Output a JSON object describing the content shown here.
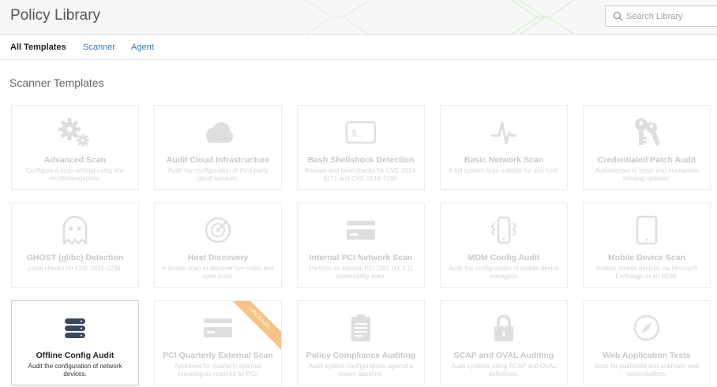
{
  "header": {
    "title": "Policy Library",
    "search_placeholder": "Search Library"
  },
  "tabs": [
    {
      "label": "All Templates"
    },
    {
      "label": "Scanner"
    },
    {
      "label": "Agent"
    }
  ],
  "section_title": "Scanner Templates",
  "cards": [
    {
      "title": "Advanced Scan",
      "desc": "Configure a scan without using any recommendations.",
      "icon": "gears-icon"
    },
    {
      "title": "Audit Cloud Infrastructure",
      "desc": "Audit the configuration of third-party cloud services.",
      "icon": "cloud-icon"
    },
    {
      "title": "Bash Shellshock Detection",
      "desc": "Remote and local checks for CVE-2014-6271 and CVE-2014-7169.",
      "icon": "terminal-icon"
    },
    {
      "title": "Basic Network Scan",
      "desc": "A full system scan suitable for any host.",
      "icon": "pulse-icon"
    },
    {
      "title": "Credentialed Patch Audit",
      "desc": "Authenticate to hosts and enumerate missing updates.",
      "icon": "keys-icon"
    },
    {
      "title": "GHOST (glibc) Detection",
      "desc": "Local checks for CVE-2015-0235.",
      "icon": "ghost-icon"
    },
    {
      "title": "Host Discovery",
      "desc": "A simple scan to discover live hosts and open ports.",
      "icon": "radar-icon"
    },
    {
      "title": "Internal PCI Network Scan",
      "desc": "Perform an internal PCI DSS (11.2.1) vulnerability scan.",
      "icon": "credit-card-icon"
    },
    {
      "title": "MDM Config Audit",
      "desc": "Audit the configuration of mobile device managers.",
      "icon": "mobile-vibrate-icon"
    },
    {
      "title": "Mobile Device Scan",
      "desc": "Assess mobile devices via Microsoft Exchange or an MDM.",
      "icon": "tablet-icon"
    },
    {
      "title": "Offline Config Audit",
      "desc": "Audit the configuration of network devices.",
      "icon": "server-stack-icon"
    },
    {
      "title": "PCI Quarterly External Scan",
      "desc": "Approved for quarterly external scanning as required by PCI.",
      "icon": "credit-card-icon",
      "ribbon": "UPGRADE"
    },
    {
      "title": "Policy Compliance Auditing",
      "desc": "Audit system configurations against a known baseline.",
      "icon": "clipboard-icon"
    },
    {
      "title": "SCAP and OVAL Auditing",
      "desc": "Audit systems using SCAP and OVAL definitions.",
      "icon": "lock-icon"
    },
    {
      "title": "Web Application Tests",
      "desc": "Scan for published and unknown web vulnerabilities.",
      "icon": "compass-icon"
    }
  ],
  "colors": {
    "link": "#3a7abf",
    "icon_gray": "#9a9a9a",
    "icon_dark": "#3a4a5e",
    "ribbon": "#f3c486"
  }
}
